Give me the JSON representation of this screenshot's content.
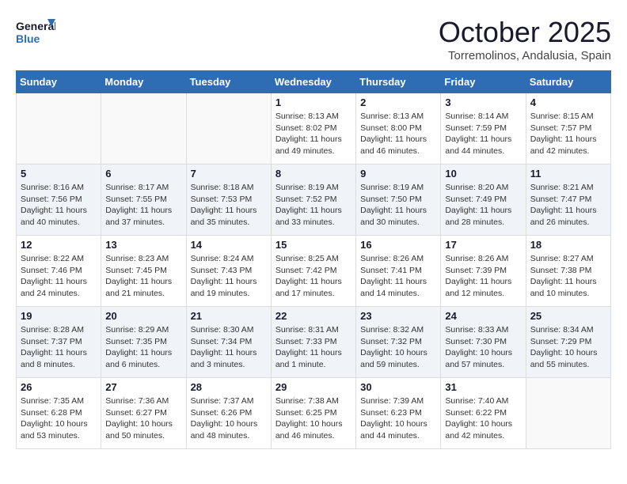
{
  "header": {
    "logo_line1": "General",
    "logo_line2": "Blue",
    "month": "October 2025",
    "location": "Torremolinos, Andalusia, Spain"
  },
  "days_of_week": [
    "Sunday",
    "Monday",
    "Tuesday",
    "Wednesday",
    "Thursday",
    "Friday",
    "Saturday"
  ],
  "weeks": [
    [
      {
        "day": "",
        "info": ""
      },
      {
        "day": "",
        "info": ""
      },
      {
        "day": "",
        "info": ""
      },
      {
        "day": "1",
        "info": "Sunrise: 8:13 AM\nSunset: 8:02 PM\nDaylight: 11 hours\nand 49 minutes."
      },
      {
        "day": "2",
        "info": "Sunrise: 8:13 AM\nSunset: 8:00 PM\nDaylight: 11 hours\nand 46 minutes."
      },
      {
        "day": "3",
        "info": "Sunrise: 8:14 AM\nSunset: 7:59 PM\nDaylight: 11 hours\nand 44 minutes."
      },
      {
        "day": "4",
        "info": "Sunrise: 8:15 AM\nSunset: 7:57 PM\nDaylight: 11 hours\nand 42 minutes."
      }
    ],
    [
      {
        "day": "5",
        "info": "Sunrise: 8:16 AM\nSunset: 7:56 PM\nDaylight: 11 hours\nand 40 minutes."
      },
      {
        "day": "6",
        "info": "Sunrise: 8:17 AM\nSunset: 7:55 PM\nDaylight: 11 hours\nand 37 minutes."
      },
      {
        "day": "7",
        "info": "Sunrise: 8:18 AM\nSunset: 7:53 PM\nDaylight: 11 hours\nand 35 minutes."
      },
      {
        "day": "8",
        "info": "Sunrise: 8:19 AM\nSunset: 7:52 PM\nDaylight: 11 hours\nand 33 minutes."
      },
      {
        "day": "9",
        "info": "Sunrise: 8:19 AM\nSunset: 7:50 PM\nDaylight: 11 hours\nand 30 minutes."
      },
      {
        "day": "10",
        "info": "Sunrise: 8:20 AM\nSunset: 7:49 PM\nDaylight: 11 hours\nand 28 minutes."
      },
      {
        "day": "11",
        "info": "Sunrise: 8:21 AM\nSunset: 7:47 PM\nDaylight: 11 hours\nand 26 minutes."
      }
    ],
    [
      {
        "day": "12",
        "info": "Sunrise: 8:22 AM\nSunset: 7:46 PM\nDaylight: 11 hours\nand 24 minutes."
      },
      {
        "day": "13",
        "info": "Sunrise: 8:23 AM\nSunset: 7:45 PM\nDaylight: 11 hours\nand 21 minutes."
      },
      {
        "day": "14",
        "info": "Sunrise: 8:24 AM\nSunset: 7:43 PM\nDaylight: 11 hours\nand 19 minutes."
      },
      {
        "day": "15",
        "info": "Sunrise: 8:25 AM\nSunset: 7:42 PM\nDaylight: 11 hours\nand 17 minutes."
      },
      {
        "day": "16",
        "info": "Sunrise: 8:26 AM\nSunset: 7:41 PM\nDaylight: 11 hours\nand 14 minutes."
      },
      {
        "day": "17",
        "info": "Sunrise: 8:26 AM\nSunset: 7:39 PM\nDaylight: 11 hours\nand 12 minutes."
      },
      {
        "day": "18",
        "info": "Sunrise: 8:27 AM\nSunset: 7:38 PM\nDaylight: 11 hours\nand 10 minutes."
      }
    ],
    [
      {
        "day": "19",
        "info": "Sunrise: 8:28 AM\nSunset: 7:37 PM\nDaylight: 11 hours\nand 8 minutes."
      },
      {
        "day": "20",
        "info": "Sunrise: 8:29 AM\nSunset: 7:35 PM\nDaylight: 11 hours\nand 6 minutes."
      },
      {
        "day": "21",
        "info": "Sunrise: 8:30 AM\nSunset: 7:34 PM\nDaylight: 11 hours\nand 3 minutes."
      },
      {
        "day": "22",
        "info": "Sunrise: 8:31 AM\nSunset: 7:33 PM\nDaylight: 11 hours\nand 1 minute."
      },
      {
        "day": "23",
        "info": "Sunrise: 8:32 AM\nSunset: 7:32 PM\nDaylight: 10 hours\nand 59 minutes."
      },
      {
        "day": "24",
        "info": "Sunrise: 8:33 AM\nSunset: 7:30 PM\nDaylight: 10 hours\nand 57 minutes."
      },
      {
        "day": "25",
        "info": "Sunrise: 8:34 AM\nSunset: 7:29 PM\nDaylight: 10 hours\nand 55 minutes."
      }
    ],
    [
      {
        "day": "26",
        "info": "Sunrise: 7:35 AM\nSunset: 6:28 PM\nDaylight: 10 hours\nand 53 minutes."
      },
      {
        "day": "27",
        "info": "Sunrise: 7:36 AM\nSunset: 6:27 PM\nDaylight: 10 hours\nand 50 minutes."
      },
      {
        "day": "28",
        "info": "Sunrise: 7:37 AM\nSunset: 6:26 PM\nDaylight: 10 hours\nand 48 minutes."
      },
      {
        "day": "29",
        "info": "Sunrise: 7:38 AM\nSunset: 6:25 PM\nDaylight: 10 hours\nand 46 minutes."
      },
      {
        "day": "30",
        "info": "Sunrise: 7:39 AM\nSunset: 6:23 PM\nDaylight: 10 hours\nand 44 minutes."
      },
      {
        "day": "31",
        "info": "Sunrise: 7:40 AM\nSunset: 6:22 PM\nDaylight: 10 hours\nand 42 minutes."
      },
      {
        "day": "",
        "info": ""
      }
    ]
  ]
}
